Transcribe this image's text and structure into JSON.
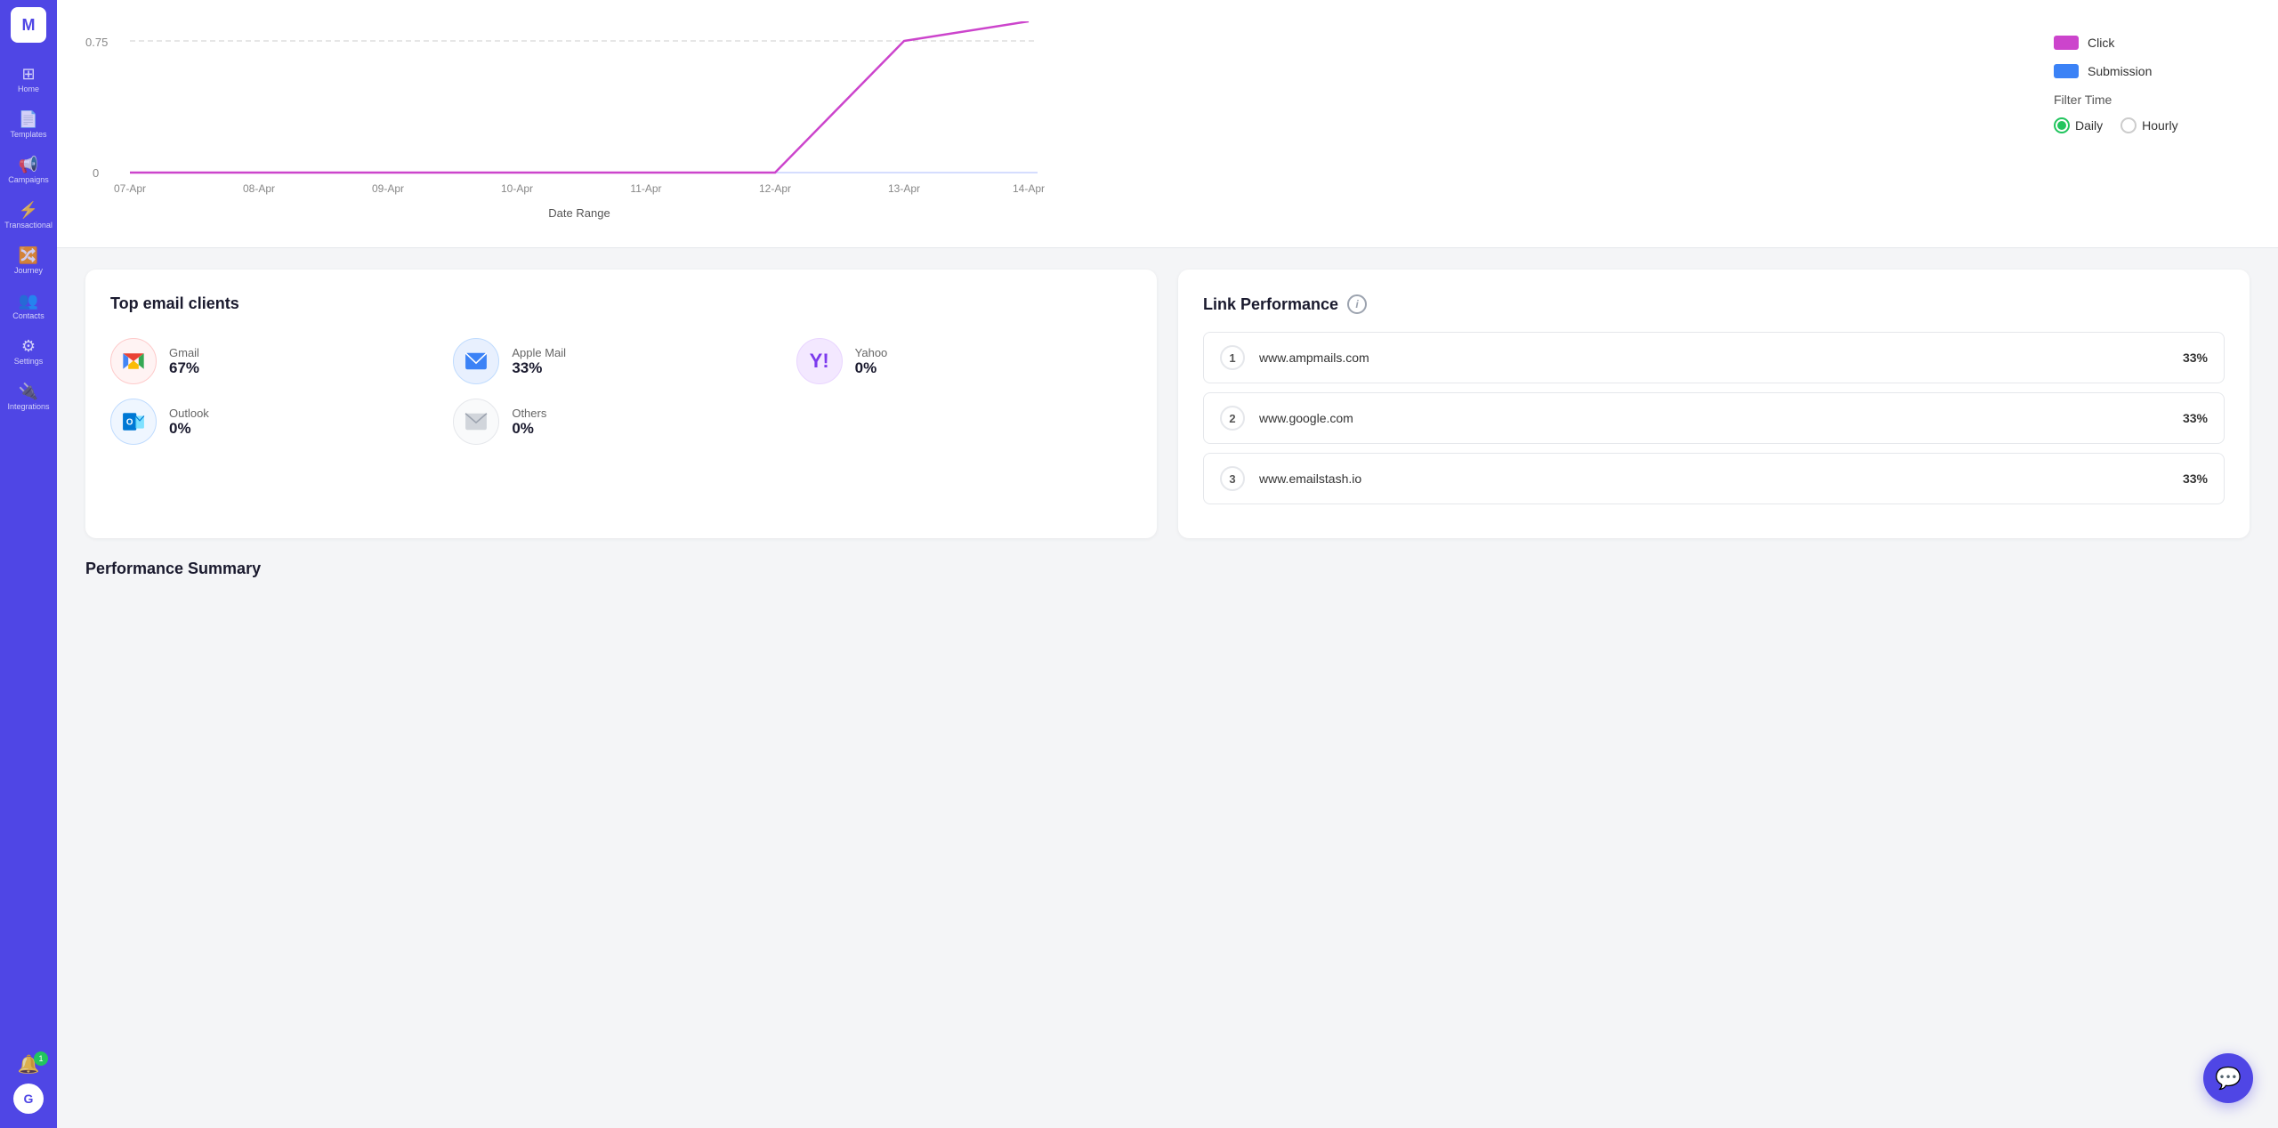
{
  "sidebar": {
    "logo_text": "M",
    "items": [
      {
        "id": "home",
        "label": "Home",
        "icon": "⊞",
        "active": false
      },
      {
        "id": "templates",
        "label": "Templates",
        "icon": "📄",
        "active": false
      },
      {
        "id": "campaigns",
        "label": "Campaigns",
        "icon": "📢",
        "active": false
      },
      {
        "id": "transactional",
        "label": "Transactional",
        "icon": "⚡",
        "active": false
      },
      {
        "id": "journey",
        "label": "Journey",
        "icon": "🔀",
        "active": false
      },
      {
        "id": "contacts",
        "label": "Contacts",
        "icon": "👥",
        "active": false
      },
      {
        "id": "settings",
        "label": "Settings",
        "icon": "⚙",
        "active": false
      },
      {
        "id": "integrations",
        "label": "Integrations",
        "icon": "🔌",
        "active": false
      }
    ],
    "notif_count": "1",
    "avatar_letter": "G"
  },
  "chart": {
    "y_values": [
      "0.75",
      "0"
    ],
    "x_labels": [
      "07-Apr",
      "08-Apr",
      "09-Apr",
      "10-Apr",
      "11-Apr",
      "12-Apr",
      "13-Apr",
      "14-Apr"
    ],
    "x_axis_label": "Date Range"
  },
  "legend": {
    "items": [
      {
        "label": "Click",
        "color": "#cc44cc"
      },
      {
        "label": "Submission",
        "color": "#3b82f6"
      }
    ]
  },
  "filter_time": {
    "label": "Filter Time",
    "options": [
      {
        "value": "daily",
        "label": "Daily",
        "selected": true
      },
      {
        "value": "hourly",
        "label": "Hourly",
        "selected": false
      }
    ]
  },
  "email_clients": {
    "title": "Top email clients",
    "items": [
      {
        "name": "Gmail",
        "pct": "67%",
        "icon": "M"
      },
      {
        "name": "Apple Mail",
        "pct": "33%",
        "icon": "✉"
      },
      {
        "name": "Yahoo",
        "pct": "0%",
        "icon": "Y"
      },
      {
        "name": "Outlook",
        "pct": "0%",
        "icon": "O"
      },
      {
        "name": "Others",
        "pct": "0%",
        "icon": "✉"
      }
    ]
  },
  "link_performance": {
    "title": "Link Performance",
    "rows": [
      {
        "rank": "1",
        "url": "www.ampmails.com",
        "pct": "33%"
      },
      {
        "rank": "2",
        "url": "www.google.com",
        "pct": "33%"
      },
      {
        "rank": "3",
        "url": "www.emailstash.io",
        "pct": "33%"
      }
    ]
  },
  "performance_summary": {
    "title": "Performance Summary"
  }
}
